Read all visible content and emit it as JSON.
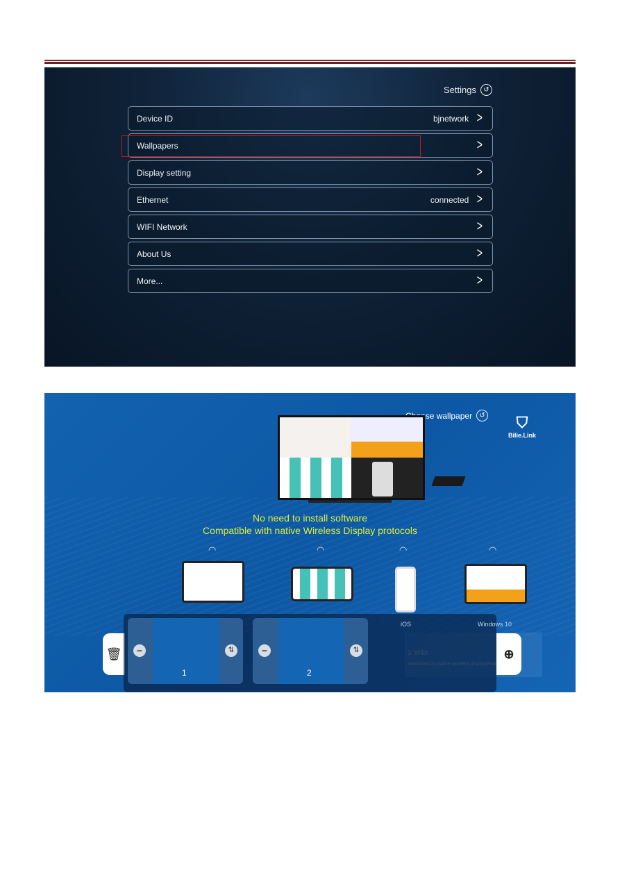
{
  "settings": {
    "title": "Settings",
    "back_icon": "back-circle-icon",
    "rows": [
      {
        "label": "Device  ID",
        "value": "bjnetwork"
      },
      {
        "label": "Wallpapers",
        "value": ""
      },
      {
        "label": "Display setting",
        "value": ""
      },
      {
        "label": "Ethernet",
        "value": "connected"
      },
      {
        "label": "WIFI Network",
        "value": ""
      },
      {
        "label": "About Us",
        "value": ""
      },
      {
        "label": "More...",
        "value": ""
      }
    ],
    "highlight_color": "#c8141e"
  },
  "wallpaper": {
    "title": "Choose wallpaper",
    "logo": "Bille Link",
    "slogan1": "No need to install software",
    "slogan2": "Compatible with native Wireless Display protocols",
    "device_labels": [
      "iOS",
      "Windows 10"
    ],
    "cards": [
      {
        "number": "1"
      },
      {
        "number": "2"
      }
    ],
    "widi_title": "3. WiDi",
    "widi_desc": "Windows10's native wireless display(Hotk",
    "accent": "#d9ef3a"
  }
}
